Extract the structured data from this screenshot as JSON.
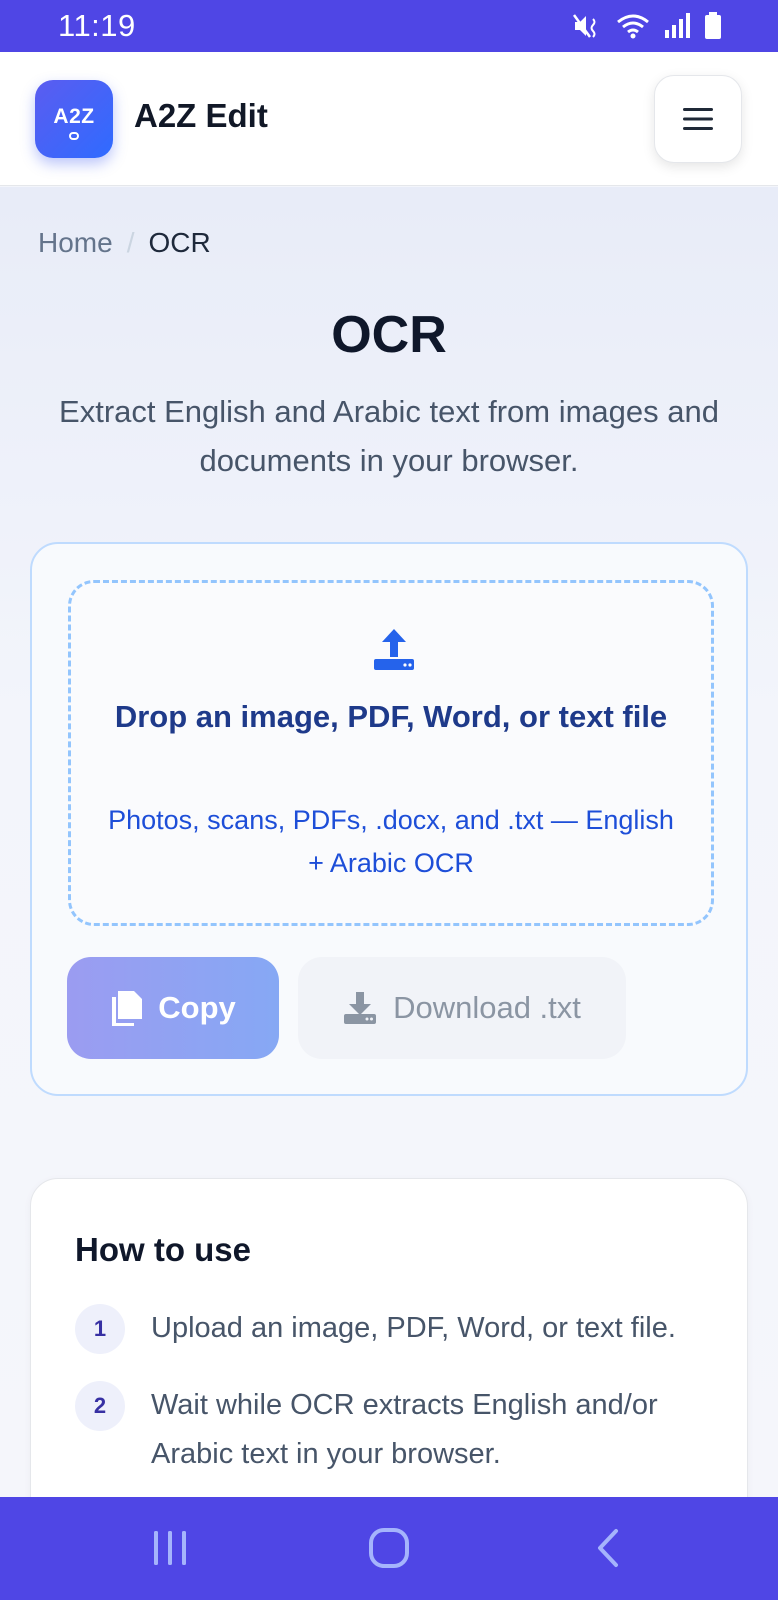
{
  "status_bar": {
    "time": "11:19",
    "icons": [
      "mute-vibrate-icon",
      "wifi-icon",
      "signal-icon",
      "battery-icon"
    ]
  },
  "header": {
    "logo_text": "A2Z",
    "app_name": "A2Z Edit",
    "menu_icon": "hamburger-menu-icon"
  },
  "breadcrumb": {
    "home": "Home",
    "separator": "/",
    "current": "OCR"
  },
  "page": {
    "title": "OCR",
    "subtitle": "Extract English and Arabic text from images and documents in your browser."
  },
  "tool": {
    "dropzone_icon": "upload-icon",
    "dropzone_title": "Drop an image, PDF, Word, or text file",
    "dropzone_hint": "Photos, scans, PDFs, .docx, and .txt — English + Arabic OCR",
    "copy_label": "Copy",
    "download_label": "Download .txt"
  },
  "how_to": {
    "title": "How to use",
    "steps": [
      {
        "number": "1",
        "text": "Upload an image, PDF, Word, or text file."
      },
      {
        "number": "2",
        "text": "Wait while OCR extracts English and/or Arabic text in your browser."
      }
    ]
  },
  "colors": {
    "accent": "#4f46e5",
    "brand_blue": "#2f6bff",
    "dropzone_title": "#1e3a8a",
    "dropzone_hint": "#1d4ed8"
  },
  "nav_bar": {
    "buttons": [
      "recent-apps-icon",
      "home-icon",
      "back-icon"
    ]
  }
}
